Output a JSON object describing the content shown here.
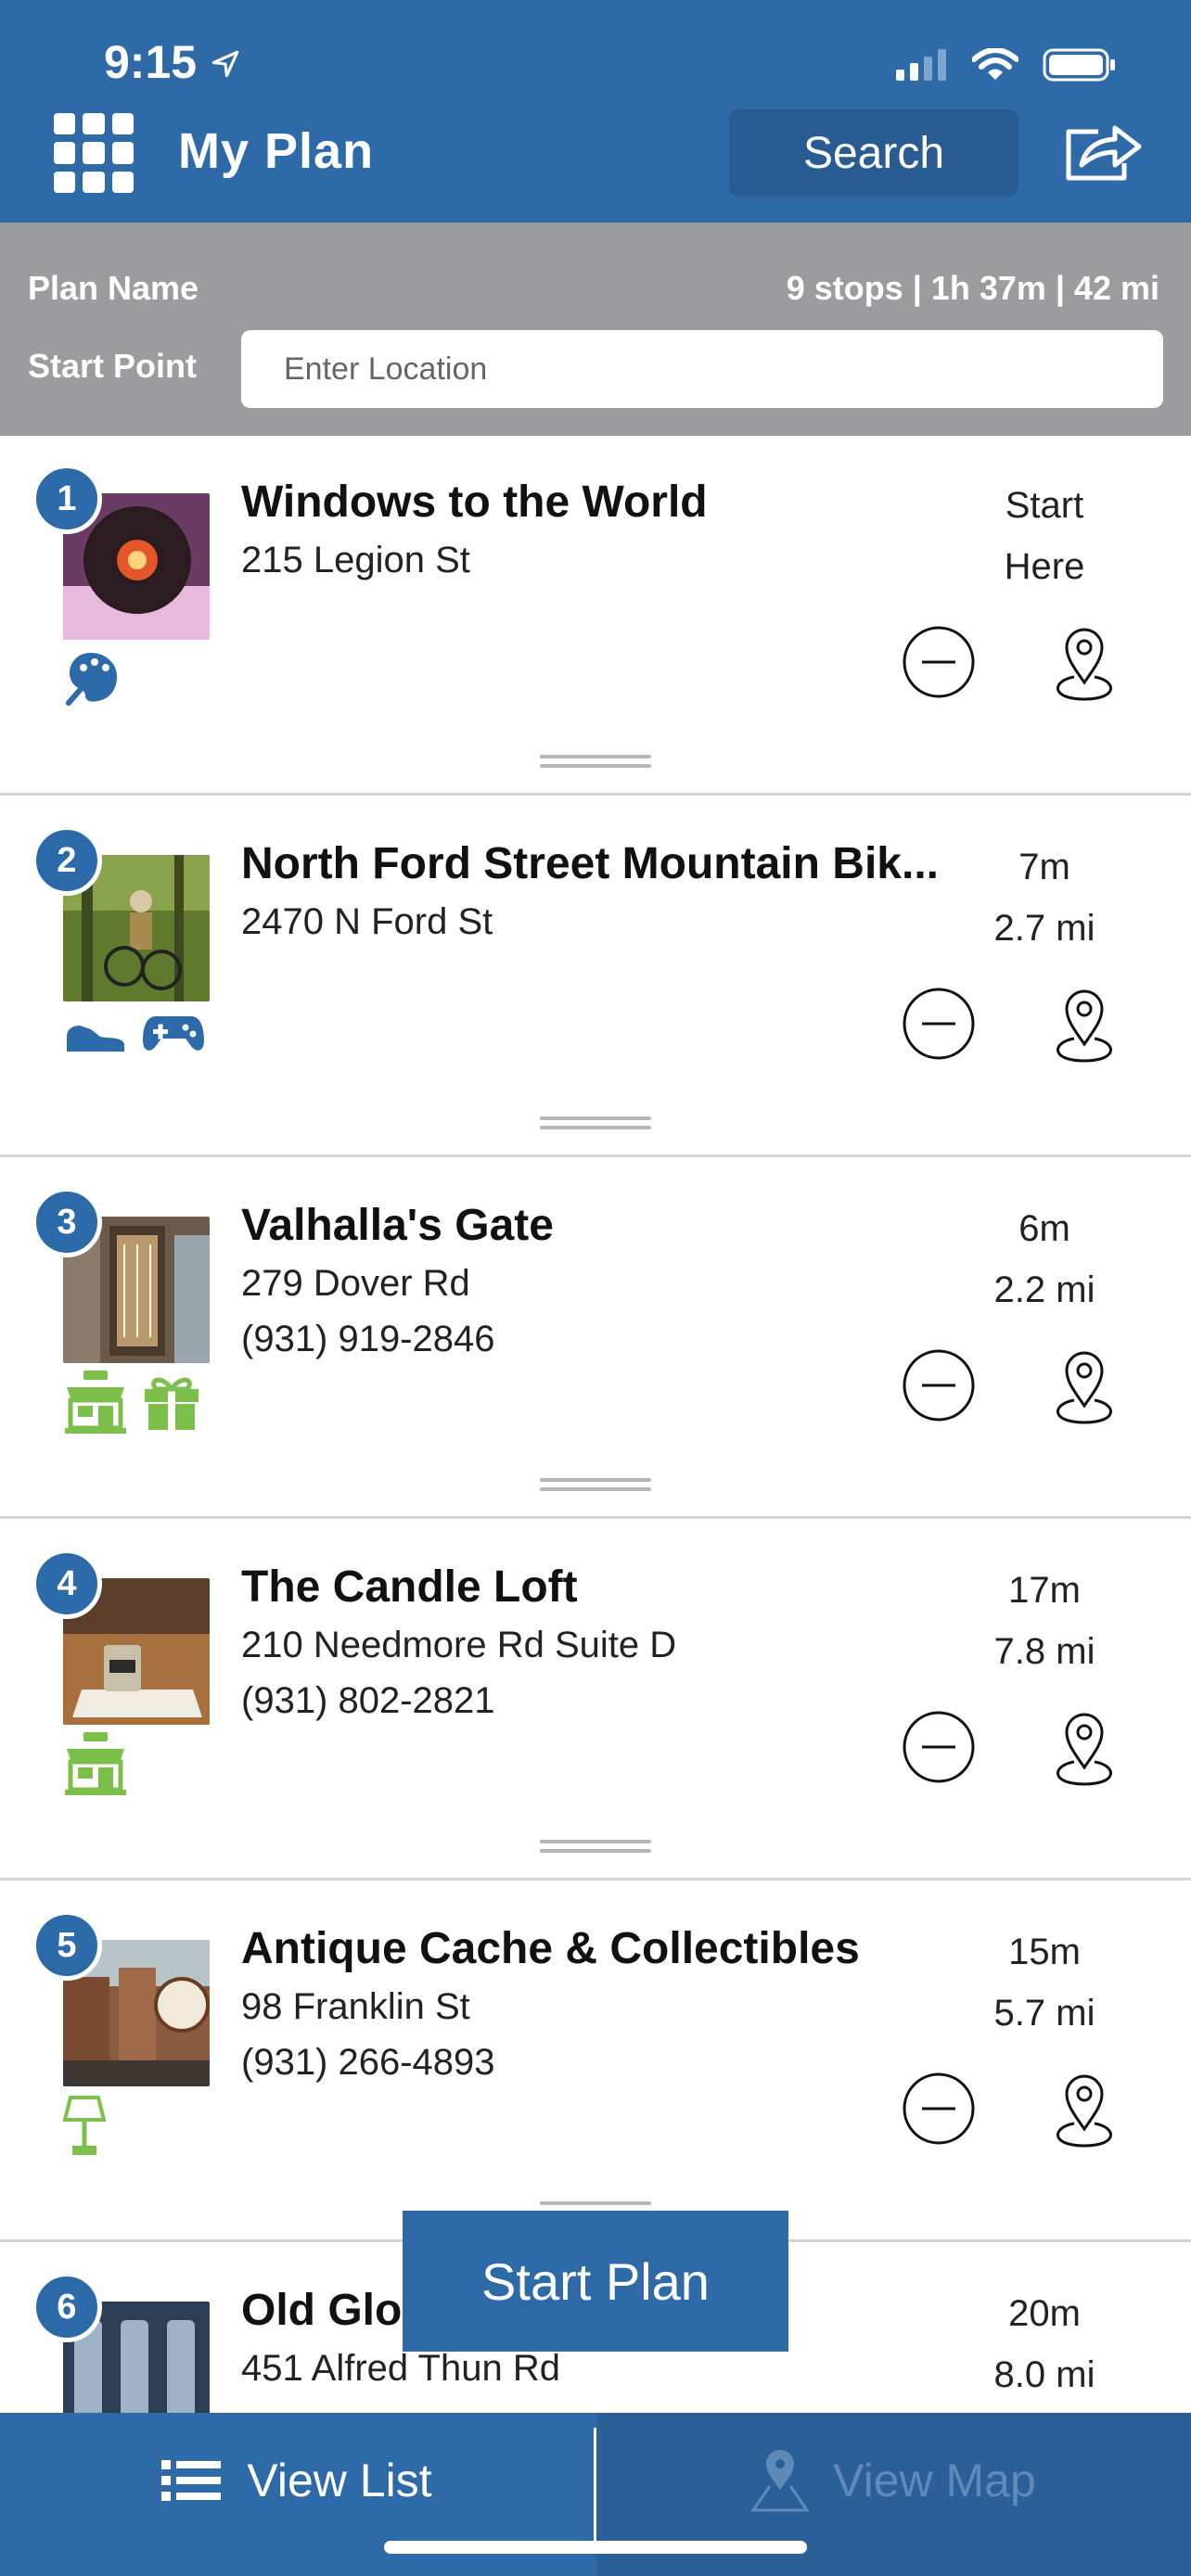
{
  "status": {
    "time": "9:15"
  },
  "header": {
    "title": "My Plan",
    "search_label": "Search"
  },
  "plan": {
    "name_label": "Plan Name",
    "stats": "9 stops | 1h 37m | 42 mi",
    "start_label": "Start Point",
    "start_placeholder": "Enter Location"
  },
  "colors": {
    "brand_blue": "#2f6aa8",
    "category_blue": "#2d6aaa",
    "category_green": "#7cbf4b"
  },
  "stops": [
    {
      "number": "1",
      "name": "Windows to the World",
      "address": "215 Legion St",
      "phone": "",
      "time": "Start",
      "distance": "Here",
      "categories": [
        "palette-icon"
      ]
    },
    {
      "number": "2",
      "name": "North Ford Street Mountain Bik...",
      "address": "2470 N Ford St",
      "phone": "",
      "time": "7m",
      "distance": "2.7 mi",
      "categories": [
        "sneaker-icon",
        "gamepad-icon"
      ]
    },
    {
      "number": "3",
      "name": "Valhalla's Gate",
      "address": "279 Dover Rd",
      "phone": "(931) 919-2846",
      "time": "6m",
      "distance": "2.2 mi",
      "categories": [
        "shop-icon",
        "gift-icon"
      ]
    },
    {
      "number": "4",
      "name": "The Candle Loft",
      "address": "210 Needmore Rd Suite D",
      "phone": "(931) 802-2821",
      "time": "17m",
      "distance": "7.8 mi",
      "categories": [
        "shop-icon"
      ]
    },
    {
      "number": "5",
      "name": "Antique Cache & Collectibles",
      "address": "98 Franklin St",
      "phone": "(931) 266-4893",
      "time": "15m",
      "distance": "5.7 mi",
      "categories": [
        "lamp-icon"
      ]
    },
    {
      "number": "6",
      "name": "Old Glo",
      "address": "451 Alfred Thun Rd",
      "phone": "",
      "time": "20m",
      "distance": "8.0 mi",
      "categories": []
    }
  ],
  "actions": {
    "start_plan": "Start Plan"
  },
  "tabs": {
    "list_label": "View List",
    "map_label": "View Map"
  }
}
